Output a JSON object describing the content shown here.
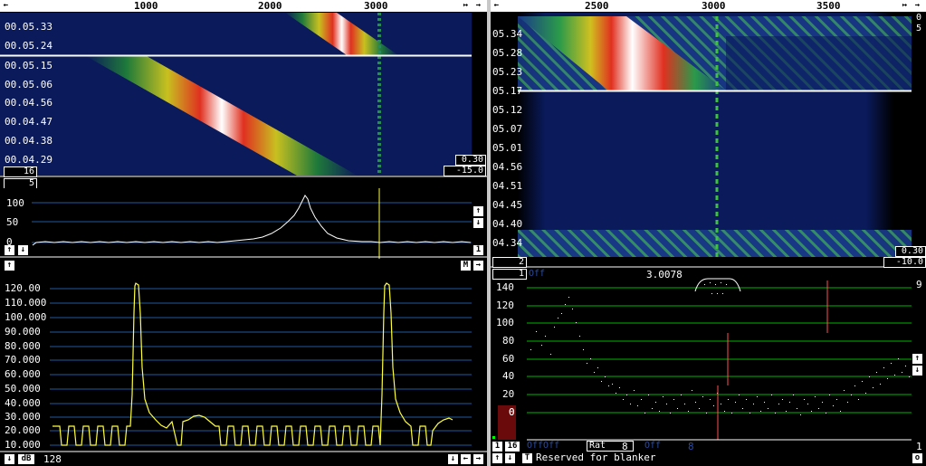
{
  "left_waterfall": {
    "ruler_ticks": [
      "1000",
      "2000",
      "3000"
    ],
    "time_labels": [
      "00.05.33",
      "00.05.24",
      "00.05.15",
      "00.05.06",
      "00.04.56",
      "00.04.47",
      "00.04.38",
      "00.04.29"
    ],
    "gain_value": "0.30",
    "offset_value": "-15.0",
    "avg_value": "16",
    "lin_value": "5"
  },
  "left_spectrum": {
    "y_labels": [
      "100",
      "50",
      "0"
    ],
    "avg_button": "1"
  },
  "timing_graph": {
    "y_labels": [
      "120.00",
      "110.000",
      "100.000",
      "90.000",
      "80.000",
      "70.000",
      "60.000",
      "50.000",
      "40.000",
      "30.000",
      "20.000",
      "10.000"
    ],
    "mode_button": "M",
    "bottom_left": "dB",
    "bottom_value": "128"
  },
  "right_waterfall": {
    "ruler_ticks": [
      "2500",
      "3000",
      "3500"
    ],
    "time_labels": [
      "05.34",
      "05.28",
      "05.23",
      "05.17",
      "05.12",
      "05.07",
      "05.01",
      "04.56",
      "04.51",
      "04.45",
      "04.40",
      "04.34"
    ],
    "right_top_labels": [
      "0",
      "5"
    ],
    "gain_value": "0.30",
    "offset_value": "-10.0",
    "avg_value": "2"
  },
  "right_graph": {
    "channel_num": "1",
    "channel_state": "Off",
    "frequency_readout": "3.0078",
    "y_labels": [
      "140",
      "120",
      "100",
      "80",
      "60",
      "40",
      "20",
      "0"
    ],
    "right_label": "9",
    "right_bottom": "1",
    "bar_value": "0",
    "status_1": "1",
    "status_16": "16",
    "status_offoff": "OffOff",
    "status_rat_label": "Rat",
    "status_rat_value": "8",
    "status_off": "Off",
    "status_off_value": "8",
    "blanker_text": "Reserved for blanker",
    "t_button": "T",
    "o_button": "o"
  },
  "colors": {
    "waterfall_bg": "#0a1a5a",
    "grid_line": "#1e5aa0",
    "graph_green": "#00b400",
    "trace_yellow": "#ffff40",
    "marker_red": "#ff5050"
  }
}
